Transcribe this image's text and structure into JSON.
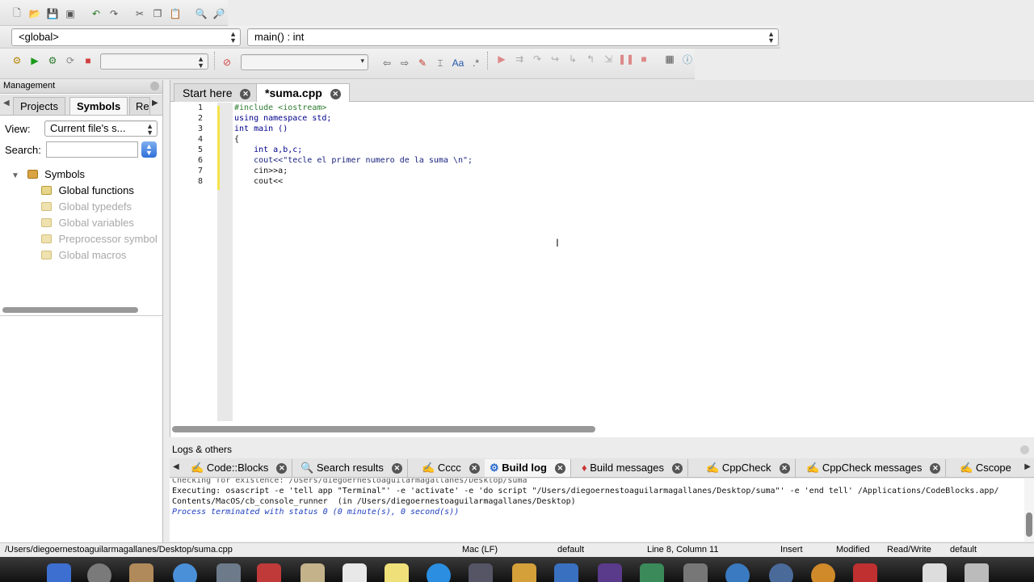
{
  "scope_combo": {
    "value": "<global>"
  },
  "function_combo": {
    "value": "main() : int"
  },
  "management": {
    "title": "Management",
    "tabs": [
      "Projects",
      "Symbols",
      "Re"
    ],
    "view_label": "View:",
    "view_value": "Current file's s...",
    "search_label": "Search:",
    "search_value": "",
    "tree_root": "Symbols",
    "tree_items": [
      "Global functions",
      "Global typedefs",
      "Global variables",
      "Preprocessor symbol",
      "Global macros"
    ]
  },
  "editor": {
    "tabs": [
      {
        "label": "Start here"
      },
      {
        "label": "*suma.cpp"
      }
    ],
    "lines": [
      {
        "num": "1",
        "text": "#include <iostream>"
      },
      {
        "num": "2",
        "text": "using namespace std;"
      },
      {
        "num": "3",
        "text": "int main ()"
      },
      {
        "num": "4",
        "text": "{"
      },
      {
        "num": "5",
        "text": "    int a,b,c;"
      },
      {
        "num": "6",
        "text": "    cout<<\"tecle el primer numero de la suma \\n\";"
      },
      {
        "num": "7",
        "text": "    cin>>a;"
      },
      {
        "num": "8",
        "text": "    cout<<"
      }
    ]
  },
  "logs": {
    "title": "Logs & others",
    "tabs": [
      "Code::Blocks",
      "Search results",
      "Cccc",
      "Build log",
      "Build messages",
      "CppCheck",
      "CppCheck messages",
      "Cscope"
    ],
    "lines": [
      "Checking for existence: /Users/diegoernestoaguilarmagallanes/Desktop/suma",
      "Executing: osascript -e 'tell app \"Terminal\"' -e 'activate' -e 'do script \"/Users/diegoernestoaguilarmagallanes/Desktop/suma\"' -e 'end tell' /Applications/CodeBlocks.app/",
      "Contents/MacOS/cb_console_runner  (in /Users/diegoernestoaguilarmagallanes/Desktop)",
      "Process terminated with status 0 (0 minute(s), 0 second(s))"
    ]
  },
  "status": {
    "path": "/Users/diegoernestoaguilarmagallanes/Desktop/suma.cpp",
    "eol": "Mac (LF)",
    "encoding": "default",
    "position": "Line 8, Column 11",
    "mode": "Insert",
    "modified": "Modified",
    "access": "Read/Write",
    "profile": "default"
  },
  "colors": {
    "accent": "#1e3fbf",
    "change_marker": "#f5e34a"
  }
}
